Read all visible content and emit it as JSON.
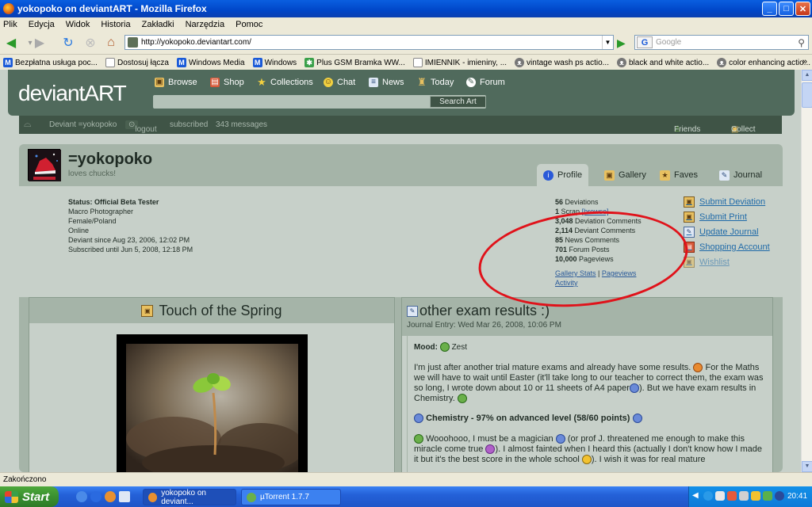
{
  "window": {
    "title": "yokopoko on deviantART - Mozilla Firefox"
  },
  "menu": {
    "items": [
      "Plik",
      "Edycja",
      "Widok",
      "Historia",
      "Zakładki",
      "Narzędzia",
      "Pomoc"
    ]
  },
  "nav": {
    "url": "http://yokopoko.deviantart.com/",
    "search_placeholder": "Google"
  },
  "bookmarks": [
    {
      "label": "Bezpłatna usługa poc...",
      "icon": "windows-media-icon"
    },
    {
      "label": "Dostosuj łącza",
      "icon": "page-icon"
    },
    {
      "label": "Windows Media",
      "icon": "windows-media-icon"
    },
    {
      "label": "Windows",
      "icon": "windows-media-icon"
    },
    {
      "label": "Plus GSM Bramka WW...",
      "icon": "star-icon"
    },
    {
      "label": "IMIENNIK - imieniny, ...",
      "icon": "page-icon"
    },
    {
      "label": "vintage wash ps actio...",
      "icon": "cat-icon"
    },
    {
      "label": "black and white actio...",
      "icon": "cat-icon"
    },
    {
      "label": "color enhancing actio...",
      "icon": "cat-icon"
    }
  ],
  "da": {
    "logo": "deviantART",
    "nav": [
      "Browse",
      "Shop",
      "Collections",
      "Chat",
      "News",
      "Today",
      "Forum"
    ],
    "search_button": "Search Art",
    "sub": {
      "deviant": "Deviant =yokopoko",
      "logout": "logout",
      "subscribed": "subscribed",
      "messages": "343 messages",
      "friends": "Friends",
      "collect": "Collect"
    }
  },
  "profile": {
    "username": "=yokopoko",
    "tagline": "loves chucks!",
    "tabs": [
      "Profile",
      "Gallery",
      "Faves",
      "Journal"
    ],
    "info": [
      "Status: Official Beta Tester",
      "Macro Photographer",
      "Female/Poland",
      "Online",
      "Deviant since Aug 23, 2006, 12:02 PM",
      "Subscribed until Jun 5, 2008, 12:18 PM"
    ],
    "stats": [
      {
        "num": "56",
        "label": "Deviations"
      },
      {
        "num": "1",
        "label": "Scrap"
      },
      {
        "num": "3,048",
        "label": "Deviation Comments"
      },
      {
        "num": "2,114",
        "label": "Deviant Comments"
      },
      {
        "num": "85",
        "label": "News Comments"
      },
      {
        "num": "701",
        "label": "Forum Posts"
      },
      {
        "num": "10,000",
        "label": "Pageviews"
      }
    ],
    "scrap_browse": "[browse]",
    "stat_links": {
      "gallery_stats": "Gallery Stats",
      "separator": "|",
      "pageviews": "Pageviews",
      "activity": "Activity"
    },
    "side_links": [
      "Submit Deviation",
      "Submit Print",
      "Update Journal",
      "Shopping Account",
      "Wishlist"
    ]
  },
  "deviation": {
    "title": "Touch of the Spring"
  },
  "journal": {
    "title": "other exam results :)",
    "entry_date": "Journal Entry: Wed Mar 26, 2008, 10:06 PM",
    "mood_label": "Mood:",
    "mood_value": "Zest",
    "para1a": "I'm just after another trial mature exams and already have some results.",
    "para1b": "For the Maths we will have to wait until Easter (it'll take long to our teacher to correct them, the exam was so long, I wrote down about 10 or 11 sheets of A4 paper",
    "para1c": "). But we have exam results in Chemistry.",
    "heading": "Chemistry - 97% on advanced level (58/60 points)",
    "para2a": "Wooohooo, I must be a magician",
    "para2b": "(or prof J. threatened me enough to make this miracle come true",
    "para2c": "). I almost fainted when I heard this (actually I don't know how I made it but it's the best score in the whole school",
    "para2d": "). I wish it was for real mature"
  },
  "statusbar": {
    "text": "Zakończono"
  },
  "taskbar": {
    "start": "Start",
    "items": [
      "yokopoko on deviant...",
      "µTorrent 1.7.7"
    ],
    "clock": "20:41"
  },
  "colors": {
    "da_header": "#506a5c",
    "da_bg": "#c7d0c9",
    "highlight_circle": "#e0121a"
  }
}
